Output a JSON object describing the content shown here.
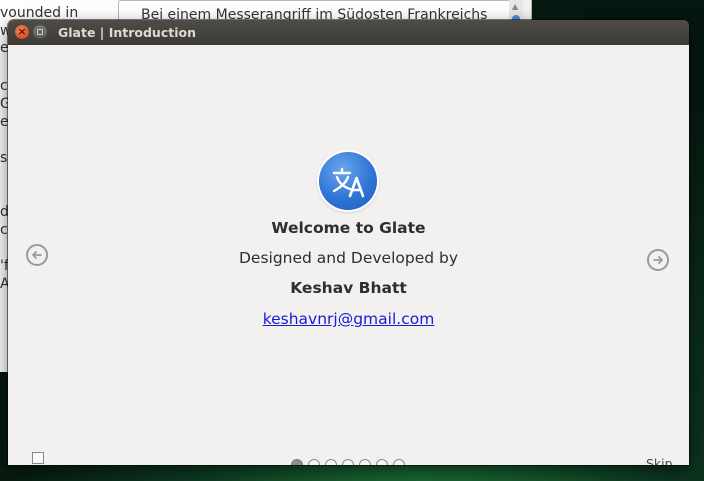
{
  "background_app": {
    "left_lines": [
      "vounded in",
      "w",
      "e",
      "",
      "co",
      "G",
      "er",
      "",
      "s",
      "",
      "da",
      "c",
      "",
      "'f",
      "Ar"
    ],
    "right_field_text": "Bei einem Messerangriff im Südosten Frankreichs"
  },
  "dialog": {
    "title": "Glate | Introduction",
    "close_symbol": "×",
    "app_icon": "translate-icon",
    "welcome": "Welcome to Glate",
    "designed_by": "Designed and Developed by",
    "author": "Keshav Bhatt",
    "email": "keshavnrj@gmail.com",
    "skip_label": "Skip",
    "pages": {
      "total": 7,
      "current": 1
    }
  },
  "colors": {
    "accent": "#2f75d6",
    "link": "#1a1ad8",
    "titlebar": "#3c3b37",
    "close_button": "#e2562b"
  }
}
